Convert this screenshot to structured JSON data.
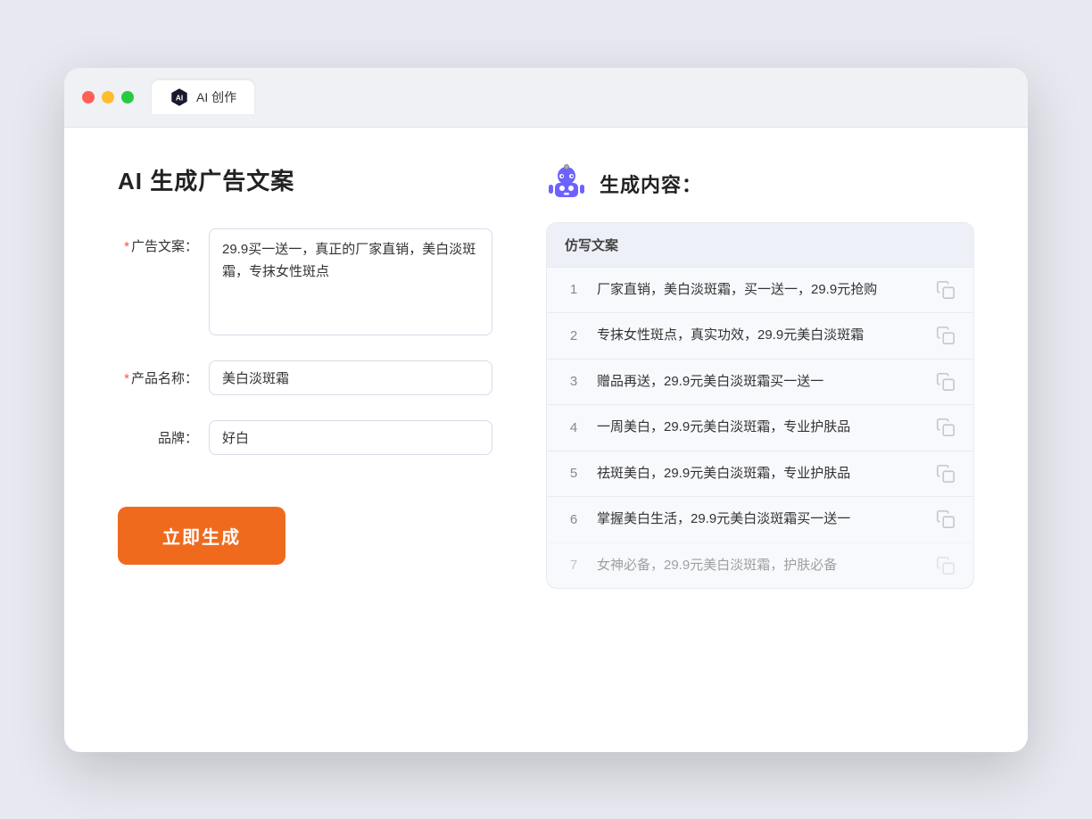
{
  "browser": {
    "tab_title": "AI 创作",
    "traffic_lights": [
      "red",
      "yellow",
      "green"
    ]
  },
  "left_panel": {
    "page_title": "AI 生成广告文案",
    "form": {
      "ad_copy_label": "广告文案：",
      "ad_copy_required": true,
      "ad_copy_value": "29.9买一送一，真正的厂家直销，美白淡斑霜，专抹女性斑点",
      "product_name_label": "产品名称：",
      "product_name_required": true,
      "product_name_value": "美白淡斑霜",
      "brand_label": "品牌：",
      "brand_required": false,
      "brand_value": "好白"
    },
    "submit_button_label": "立即生成"
  },
  "right_panel": {
    "result_title": "生成内容：",
    "table_header": "仿写文案",
    "results": [
      {
        "num": 1,
        "text": "厂家直销，美白淡斑霜，买一送一，29.9元抢购"
      },
      {
        "num": 2,
        "text": "专抹女性斑点，真实功效，29.9元美白淡斑霜"
      },
      {
        "num": 3,
        "text": "赠品再送，29.9元美白淡斑霜买一送一"
      },
      {
        "num": 4,
        "text": "一周美白，29.9元美白淡斑霜，专业护肤品"
      },
      {
        "num": 5,
        "text": "祛斑美白，29.9元美白淡斑霜，专业护肤品"
      },
      {
        "num": 6,
        "text": "掌握美白生活，29.9元美白淡斑霜买一送一"
      },
      {
        "num": 7,
        "text": "女神必备，29.9元美白淡斑霜，护肤必备"
      }
    ]
  }
}
